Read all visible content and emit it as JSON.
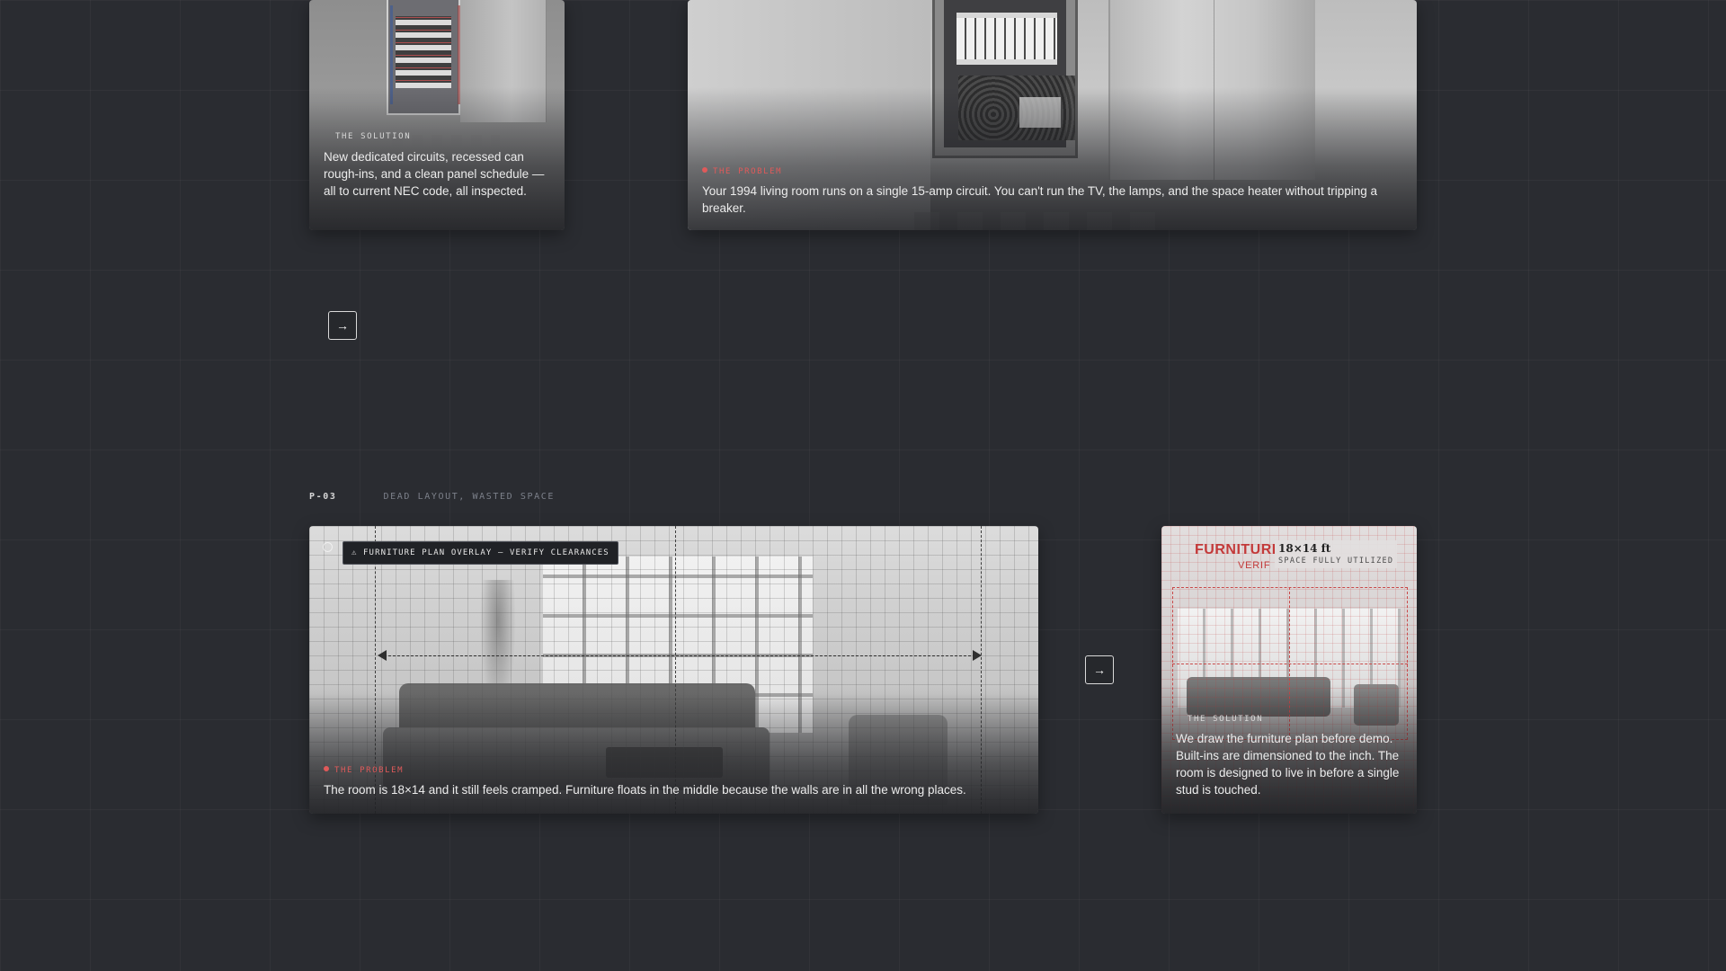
{
  "colors": {
    "background": "#2a2c31",
    "problem_accent": "#e05a5a",
    "solution_tag": "#d8d8d8",
    "plan_red": "#c33a3a"
  },
  "cards": {
    "panel_solution": {
      "tag": "THE SOLUTION",
      "caption": "New dedicated circuits, recessed can rough-ins, and a clean panel schedule — all to current NEC code, all inspected."
    },
    "panel_problem": {
      "tag": "THE PROBLEM",
      "caption": "Your 1994 living room runs on a single 15-amp circuit. You can't run the TV, the lamps, and the space heater without tripping a breaker."
    },
    "layout_problem": {
      "warning": "⚠ FURNITURE PLAN OVERLAY — VERIFY CLEARANCES",
      "tag": "THE PROBLEM",
      "caption": "The room is 18×14 and it still feels cramped. Furniture floats in the middle because the walls are in all the wrong places."
    },
    "layout_solution": {
      "plan_title": "FURNITURI",
      "plan_subtitle": "VERIF",
      "dimension": "18×14 ft",
      "dimension_note": "SPACE FULLY UTILIZED",
      "tag": "THE SOLUTION",
      "caption": "We draw the furniture plan before demo. Built-ins are dimensioned to the inch. The room is designed to live in before a single stud is touched."
    }
  },
  "section": {
    "number": "P-03",
    "title": "DEAD LAYOUT, WASTED SPACE"
  },
  "controls": {
    "next_arrow": "→"
  },
  "icons": {
    "next": "arrow-right-icon",
    "warning": "warning-icon",
    "status": "status-dot-icon"
  }
}
